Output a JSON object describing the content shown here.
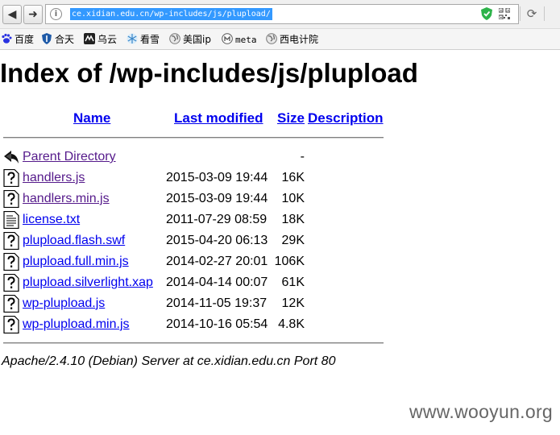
{
  "browser": {
    "back_glyph": "◀",
    "forward_glyph": "➜",
    "info_glyph": "i",
    "url": "ce.xidian.edu.cn/wp-includes/js/plupload/",
    "refresh_glyph": "⟳"
  },
  "bookmarks": [
    {
      "label": "百度",
      "icon": "baidu-paw-icon",
      "color": "#2932e1"
    },
    {
      "label": "合天",
      "icon": "hetian-shield-icon",
      "color": "#1e5aa8"
    },
    {
      "label": "乌云",
      "icon": "wooyun-icon",
      "color": "#333333"
    },
    {
      "label": "看雪",
      "icon": "kanxue-snowflake-icon",
      "color": "#5aa0d8"
    },
    {
      "label": "美国ip",
      "icon": "globe-icon",
      "color": "#777777"
    },
    {
      "label": "meta",
      "icon": "meta-icon",
      "color": "#555555"
    },
    {
      "label": "西电计院",
      "icon": "globe-icon",
      "color": "#777777"
    }
  ],
  "page": {
    "title": "Index of /wp-includes/js/plupload",
    "columns": {
      "name": "Name",
      "modified": "Last modified",
      "size": "Size",
      "description": "Description"
    },
    "parent": {
      "name": "Parent Directory",
      "size": "-"
    },
    "files": [
      {
        "name": "handlers.js",
        "modified": "2015-03-09 19:44",
        "size": "16K",
        "type": "unknown",
        "visited": true
      },
      {
        "name": "handlers.min.js",
        "modified": "2015-03-09 19:44",
        "size": "10K",
        "type": "unknown",
        "visited": true
      },
      {
        "name": "license.txt",
        "modified": "2011-07-29 08:59",
        "size": "18K",
        "type": "text",
        "visited": false
      },
      {
        "name": "plupload.flash.swf",
        "modified": "2015-04-20 06:13",
        "size": "29K",
        "type": "unknown",
        "visited": false
      },
      {
        "name": "plupload.full.min.js",
        "modified": "2014-02-27 20:01",
        "size": "106K",
        "type": "unknown",
        "visited": false
      },
      {
        "name": "plupload.silverlight.xap",
        "modified": "2014-04-14 00:07",
        "size": "61K",
        "type": "unknown",
        "visited": false
      },
      {
        "name": "wp-plupload.js",
        "modified": "2014-11-05 19:37",
        "size": "12K",
        "type": "unknown",
        "visited": false
      },
      {
        "name": "wp-plupload.min.js",
        "modified": "2014-10-16 05:54",
        "size": "4.8K",
        "type": "unknown",
        "visited": false
      }
    ],
    "server_signature": "Apache/2.4.10 (Debian) Server at ce.xidian.edu.cn Port 80",
    "link_color": "#0000ee",
    "visited_color": "#551a8b"
  },
  "watermark": "www.wooyun.org"
}
